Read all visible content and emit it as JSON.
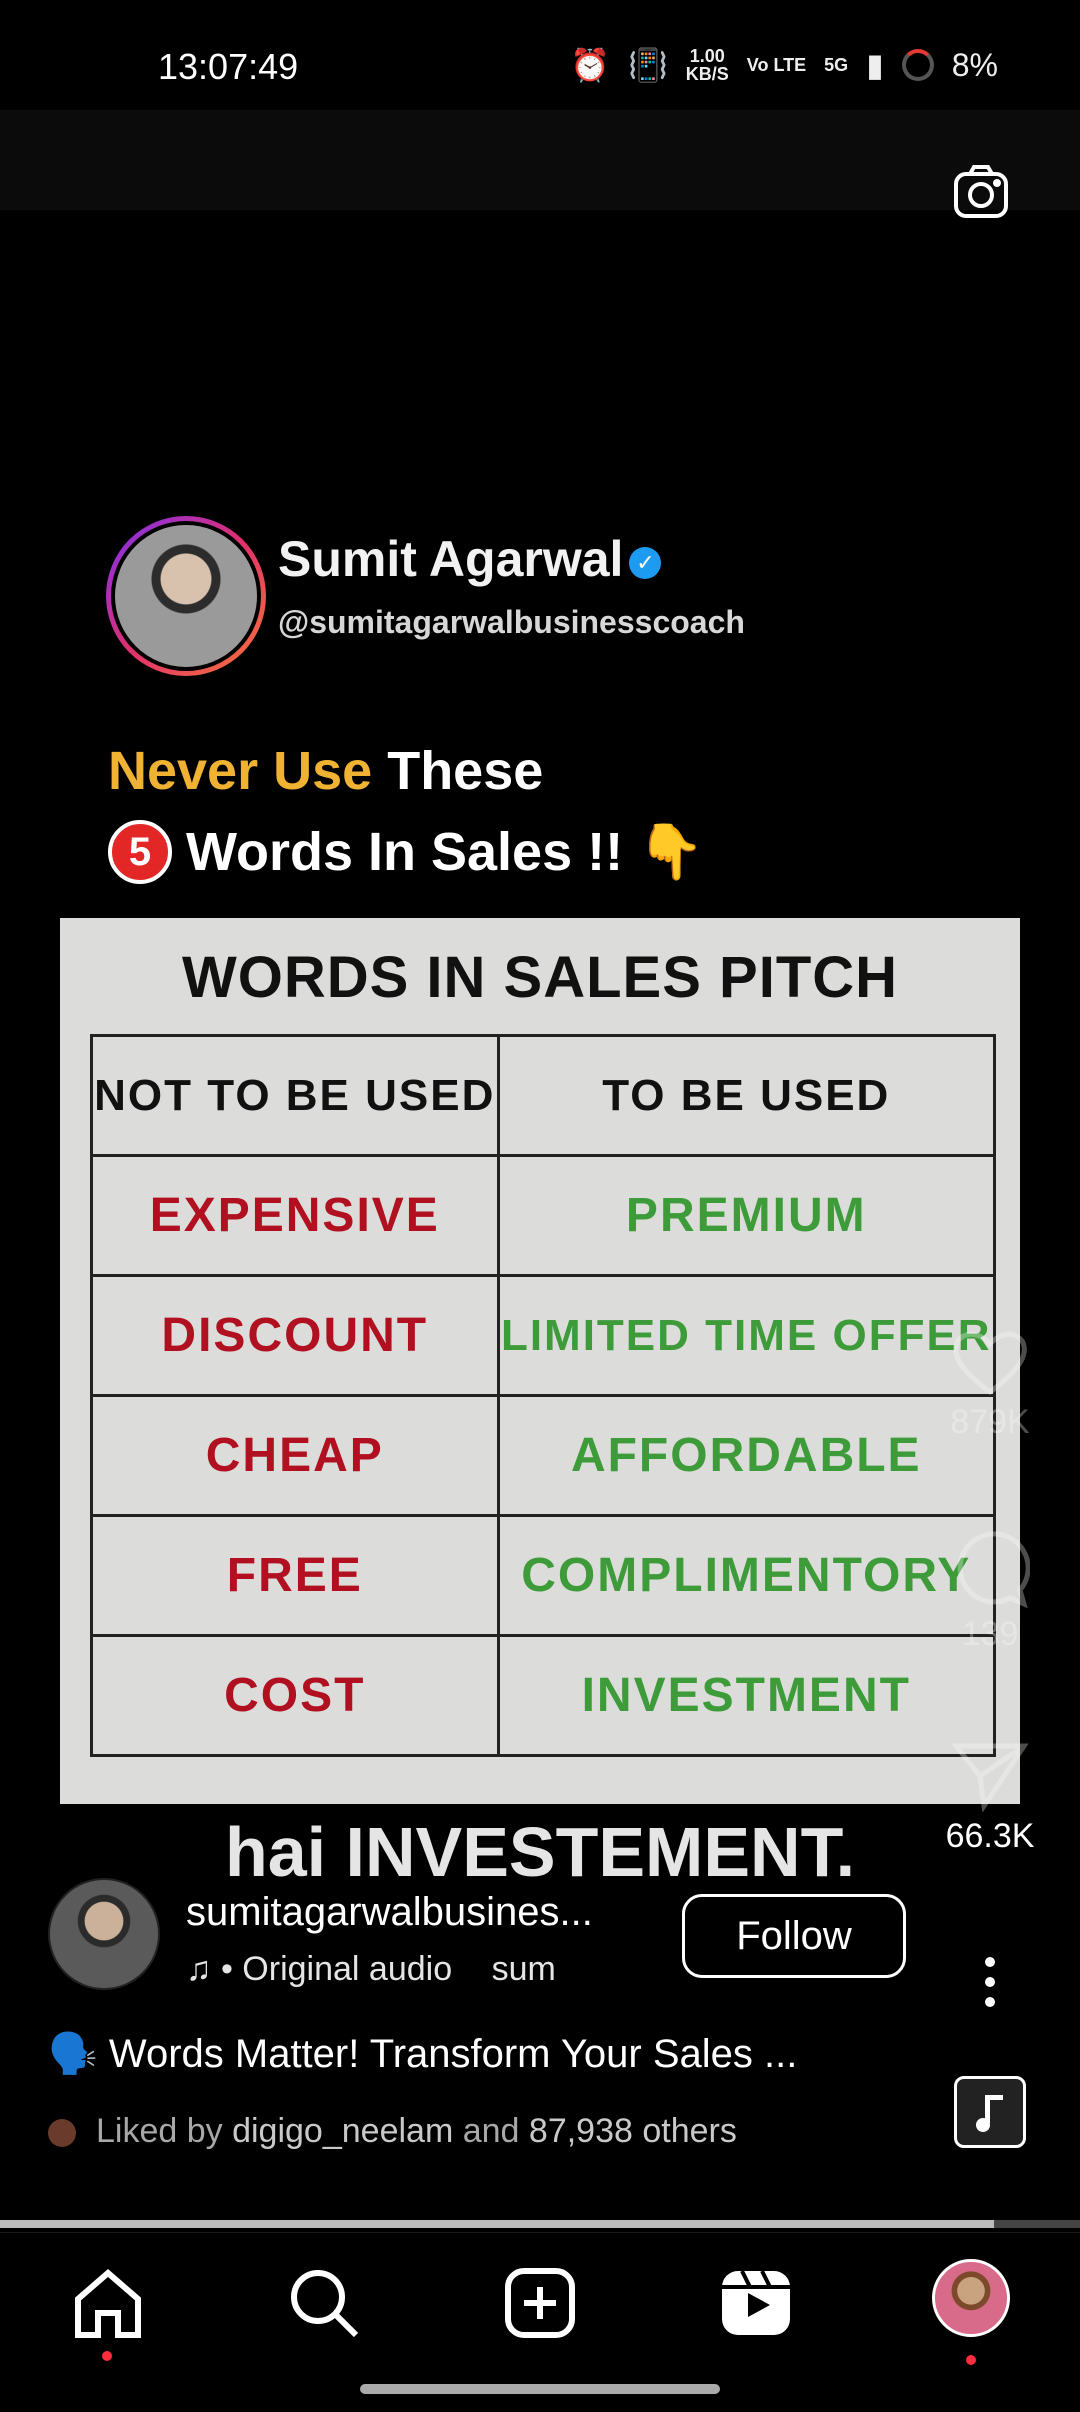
{
  "status_bar": {
    "time": "13:07:49",
    "net_speed": "1.00",
    "net_unit": "KB/S",
    "volte": "Vo LTE",
    "network": "5G",
    "battery": "8%"
  },
  "video": {
    "creator_name": "Sumit Agarwal",
    "creator_handle": "@sumitagarwalbusinesscoach",
    "headline_highlight": "Never Use",
    "headline_rest": "These",
    "headline_number": "5",
    "headline_line2": "Words In Sales !!",
    "table_title": "WORDS IN SALES PITCH",
    "table_headers": [
      "NOT TO BE USED",
      "TO BE USED"
    ],
    "rows": [
      {
        "not": "EXPENSIVE",
        "use": "PREMIUM"
      },
      {
        "not": "DISCOUNT",
        "use": "LIMITED TIME OFFER"
      },
      {
        "not": "CHEAP",
        "use": "AFFORDABLE"
      },
      {
        "not": "FREE",
        "use": "COMPLIMENTORY"
      },
      {
        "not": "COST",
        "use": "INVESTMENT"
      }
    ],
    "caption_overlay": "hai INVESTEMENT."
  },
  "actions": {
    "likes": "879K",
    "comments": "139",
    "shares": "66.3K"
  },
  "post": {
    "author": "sumitagarwalbusines...",
    "audio": "• Original audio",
    "audio_scroll": "sum",
    "follow_label": "Follow",
    "description": "🗣️ Words Matter! Transform Your Sales ...",
    "liked_prefix": "Liked by",
    "liked_user": "digigo_neelam",
    "liked_mid": "and",
    "liked_count": "87,938 others",
    "progress": 0.92
  },
  "icons": {
    "camera": "camera-icon",
    "heart": "heart-icon",
    "comment": "comment-icon",
    "share": "share-icon",
    "more": "more-vertical-icon",
    "music": "music-note-icon",
    "home": "home-icon",
    "search": "search-icon",
    "create": "plus-square-icon",
    "reels": "reels-icon"
  }
}
